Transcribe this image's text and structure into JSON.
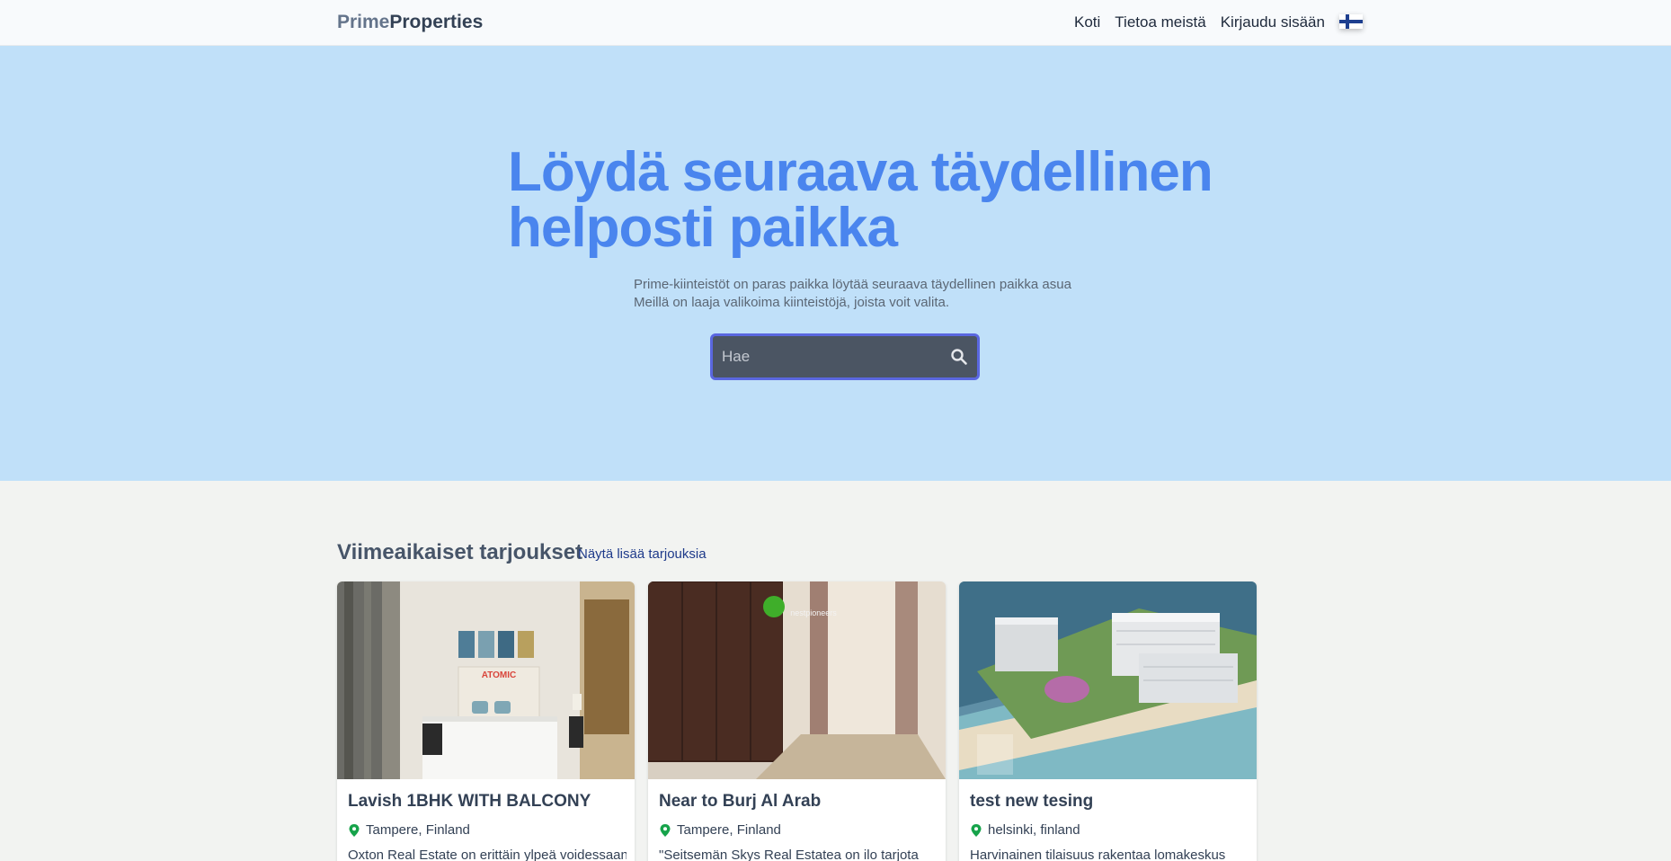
{
  "header": {
    "logo_prime": "Prime",
    "logo_properties": "Properties",
    "nav": {
      "home": "Koti",
      "about": "Tietoa meistä",
      "login": "Kirjaudu sisään"
    },
    "language_icon": "finland-flag-icon"
  },
  "hero": {
    "title": "Löydä seuraava täydellinen helposti paikka",
    "subtitle_line1": "Prime-kiinteistöt on paras paikka löytää seuraava täydellinen paikka asua",
    "subtitle_line2": "Meillä on laaja valikoima kiinteistöjä, joista voit valita.",
    "search_placeholder": "Hae",
    "search_icon": "search-icon"
  },
  "recent": {
    "title": "Viimeaikaiset tarjoukset",
    "more_link": "Näytä lisää tarjouksia",
    "listings": [
      {
        "title": "Lavish 1BHK WITH BALCONY",
        "location": "Tampere, Finland",
        "description": "Oxton Real Estate on erittäin ylpeä voidessaan",
        "image_logo_text": "ATOMIC"
      },
      {
        "title": "Near to Burj Al Arab",
        "location": "Tampere, Finland",
        "description": "\"Seitsemän Skys Real Estatea on ilo tarjota",
        "image_logo_text": "nestpioneers"
      },
      {
        "title": "test new tesing",
        "location": "helsinki, finland",
        "description": "Harvinainen tilaisuus rakentaa lomakeskus"
      }
    ]
  },
  "colors": {
    "hero_bg": "#c0e0f9",
    "hero_title": "#4a85ee",
    "search_bg": "#4b5563",
    "search_border": "#5a67e0",
    "pin_green": "#16a34a",
    "page_bg": "#f2f3f1"
  }
}
